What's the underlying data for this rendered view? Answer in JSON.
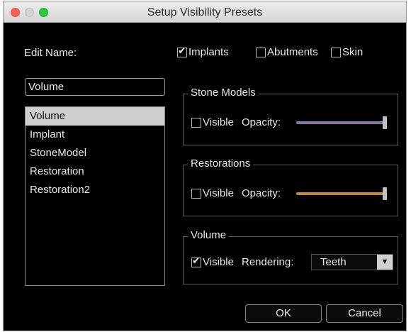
{
  "window": {
    "title": "Setup Visibility Presets"
  },
  "left": {
    "edit_name_label": "Edit Name:",
    "name_value": "Volume",
    "preset_list": [
      {
        "label": "Volume",
        "selected": true
      },
      {
        "label": "Implant",
        "selected": false
      },
      {
        "label": "StoneModel",
        "selected": false
      },
      {
        "label": "Restoration",
        "selected": false
      },
      {
        "label": "Restoration2",
        "selected": false
      }
    ]
  },
  "top_checks": {
    "implants": {
      "label": "Implants",
      "checked": true
    },
    "abutments": {
      "label": "Abutments",
      "checked": false
    },
    "skin": {
      "label": "Skin",
      "checked": false
    }
  },
  "stone_models": {
    "title": "Stone Models",
    "visible_label": "Visible",
    "visible_checked": false,
    "opacity_label": "Opacity:",
    "opacity_value": 1.0,
    "color": "#8a78a8"
  },
  "restorations": {
    "title": "Restorations",
    "visible_label": "Visible",
    "visible_checked": false,
    "opacity_label": "Opacity:",
    "opacity_value": 1.0,
    "color": "#c08a3e"
  },
  "volume": {
    "title": "Volume",
    "visible_label": "Visible",
    "visible_checked": true,
    "rendering_label": "Rendering:",
    "rendering_value": "Teeth"
  },
  "buttons": {
    "ok": "OK",
    "cancel": "Cancel"
  }
}
